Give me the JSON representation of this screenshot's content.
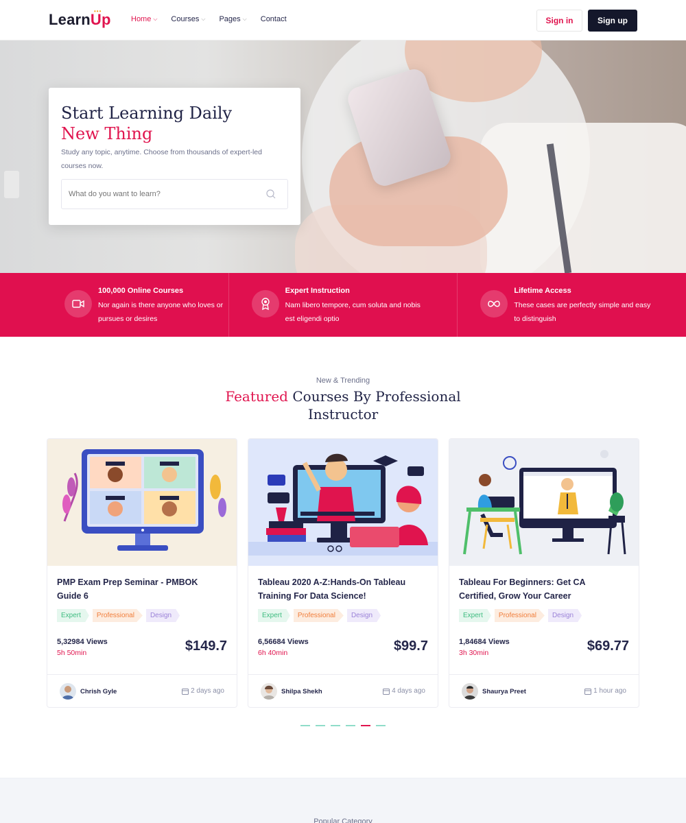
{
  "header": {
    "logo_main": "Learn",
    "logo_accent": "Up",
    "nav": [
      {
        "label": "Home",
        "active": true
      },
      {
        "label": "Courses",
        "active": false
      },
      {
        "label": "Pages",
        "active": false
      },
      {
        "label": "Contact",
        "active": false
      }
    ],
    "signin_label": "Sign in",
    "signup_label": "Sign up"
  },
  "hero": {
    "title_line1": "Start Learning Daily",
    "title_line2": "New Thing",
    "description": "Study any topic, anytime. Choose from thousands of expert-led courses now.",
    "search_placeholder": "What do you want to learn?"
  },
  "features": [
    {
      "icon": "video-camera-icon",
      "title": "100,000 Online Courses",
      "text": "Nor again is there anyone who loves or pursues or desires"
    },
    {
      "icon": "award-badge-icon",
      "title": "Expert Instruction",
      "text": "Nam libero tempore, cum soluta and nobis est eligendi optio"
    },
    {
      "icon": "infinity-icon",
      "title": "Lifetime Access",
      "text": "These cases are perfectly simple and easy to distinguish"
    }
  ],
  "section": {
    "kicker": "New & Trending",
    "title_accent": "Featured",
    "title_rest": "Courses By Professional Instructor"
  },
  "courses": [
    {
      "title": "PMP Exam Prep Seminar - PMBOK Guide 6",
      "tags": [
        "Expert",
        "Professional",
        "Design"
      ],
      "views": "5,32984 Views",
      "duration": "5h 50min",
      "price": "$149.7",
      "author": "Chrish Gyle",
      "posted": "2 days ago"
    },
    {
      "title": "Tableau 2020 A-Z:Hands-On Tableau Training For Data Science!",
      "tags": [
        "Expert",
        "Professional",
        "Design"
      ],
      "views": "6,56684 Views",
      "duration": "6h 40min",
      "price": "$99.7",
      "author": "Shilpa Shekh",
      "posted": "4 days ago"
    },
    {
      "title": "Tableau For Beginners: Get CA Certified, Grow Your Career",
      "tags": [
        "Expert",
        "Professional",
        "Design"
      ],
      "views": "1,84684 Views",
      "duration": "3h 30min",
      "price": "$69.77",
      "author": "Shaurya Preet",
      "posted": "1 hour ago"
    }
  ],
  "carousel": {
    "pages": 6,
    "active_index": 4
  },
  "next_section": {
    "kicker": "Popular Category"
  },
  "colors": {
    "accent": "#e0144e",
    "dark": "#14172b",
    "text": "#24264a"
  }
}
